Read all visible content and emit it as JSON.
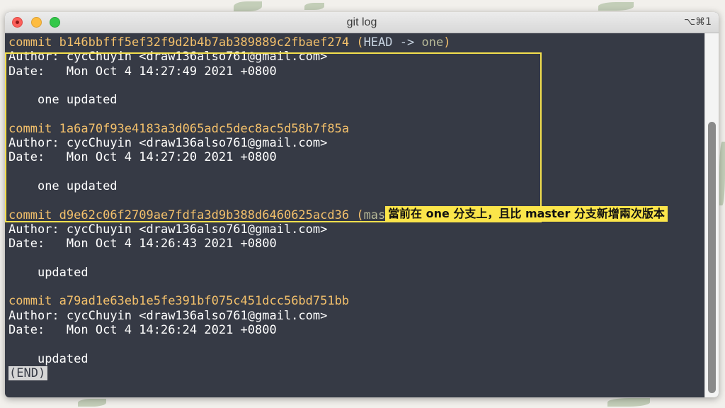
{
  "window": {
    "title": "git log",
    "shortcut": "⌥⌘1"
  },
  "terminal": {
    "commits": [
      {
        "commit_label": "commit",
        "hash": "b146bbfff5ef32f9d2b4b7ab389889c2fbaef274",
        "ref_open": " (",
        "ref_head": "HEAD ->",
        "ref_branch": "one",
        "ref_close": ")",
        "author_label": "Author:",
        "author_value": "cycChuyin <draw136also761@gmail.com>",
        "date_label": "Date:",
        "date_value": "Mon Oct 4 14:27:49 2021 +0800",
        "message": "one updated"
      },
      {
        "commit_label": "commit",
        "hash": "1a6a70f93e4183a3d065adc5dec8ac5d58b7f85a",
        "author_label": "Author:",
        "author_value": "cycChuyin <draw136also761@gmail.com>",
        "date_label": "Date:",
        "date_value": "Mon Oct 4 14:27:20 2021 +0800",
        "message": "one updated"
      },
      {
        "commit_label": "commit",
        "hash": "d9e62c06f2709ae7fdfa3d9b388d6460625acd36",
        "ref_open": " (",
        "ref_branch": "master",
        "ref_close": ")",
        "author_label": "Author:",
        "author_value": "cycChuyin <draw136also761@gmail.com>",
        "date_label": "Date:",
        "date_value": "Mon Oct 4 14:26:43 2021 +0800",
        "message": "updated"
      },
      {
        "commit_label": "commit",
        "hash": "a79ad1e63eb1e5fe391bf075c451dcc56bd751bb",
        "author_label": "Author:",
        "author_value": "cycChuyin <draw136also761@gmail.com>",
        "date_label": "Date:",
        "date_value": "Mon Oct 4 14:26:24 2021 +0800",
        "message": "updated"
      }
    ],
    "end_marker": "(END)"
  },
  "annotation": {
    "text": "當前在 one 分支上，且比 master 分支新增兩次版本"
  },
  "colors": {
    "terminal_bg": "#363a45",
    "commit_yellow": "#f3c06b",
    "branch_green": "#b8ba98",
    "head_blue": "#c7d3e0",
    "highlight_yellow": "#f4e04d"
  }
}
